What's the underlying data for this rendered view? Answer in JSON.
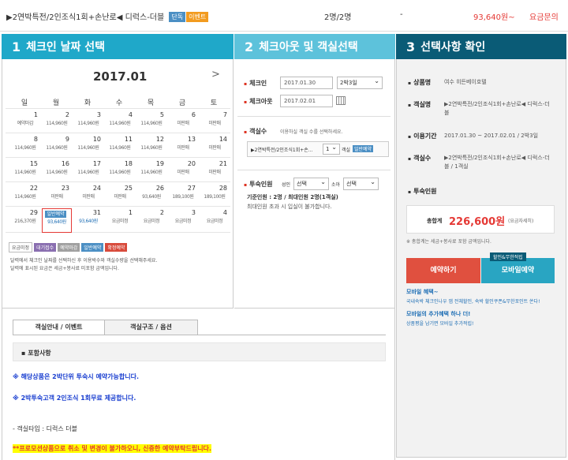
{
  "top": {
    "room_name": "▶2연박특전/2인조식1회+손난로◀ 디럭스-더블",
    "badge_single": "단독",
    "badge_event": "이벤트",
    "persons": "2명/2명",
    "dash": "-",
    "price": "93,640원~",
    "inquiry": "요금문의"
  },
  "steps": [
    {
      "num": "1",
      "label": "체크인 날짜 선택"
    },
    {
      "num": "2",
      "label": "체크아웃 및 객실선택"
    },
    {
      "num": "3",
      "label": "선택사항 확인"
    }
  ],
  "calendar": {
    "title": "2017.01",
    "next": ">",
    "weekdays": [
      "일",
      "월",
      "화",
      "수",
      "목",
      "금",
      "토"
    ],
    "weeks": [
      [
        {
          "d": "1",
          "v": "예약마감"
        },
        {
          "d": "2",
          "v": "114,960원"
        },
        {
          "d": "3",
          "v": "114,960원"
        },
        {
          "d": "4",
          "v": "114,960원"
        },
        {
          "d": "5",
          "v": "114,960원"
        },
        {
          "d": "6",
          "v": "미판매"
        },
        {
          "d": "7",
          "v": "미판매"
        }
      ],
      [
        {
          "d": "8",
          "v": "114,960원"
        },
        {
          "d": "9",
          "v": "114,960원"
        },
        {
          "d": "10",
          "v": "114,960원"
        },
        {
          "d": "11",
          "v": "114,960원"
        },
        {
          "d": "12",
          "v": "114,960원"
        },
        {
          "d": "13",
          "v": "미판매"
        },
        {
          "d": "14",
          "v": "미판매"
        }
      ],
      [
        {
          "d": "15",
          "v": "114,960원"
        },
        {
          "d": "16",
          "v": "114,960원"
        },
        {
          "d": "17",
          "v": "114,960원"
        },
        {
          "d": "18",
          "v": "114,960원"
        },
        {
          "d": "19",
          "v": "114,960원"
        },
        {
          "d": "20",
          "v": "미판매"
        },
        {
          "d": "21",
          "v": "미판매"
        }
      ],
      [
        {
          "d": "22",
          "v": "114,960원"
        },
        {
          "d": "23",
          "v": "미판매"
        },
        {
          "d": "24",
          "v": "미판매"
        },
        {
          "d": "25",
          "v": "미판매"
        },
        {
          "d": "26",
          "v": "93,640원"
        },
        {
          "d": "27",
          "v": "189,100원"
        },
        {
          "d": "28",
          "v": "189,100원"
        }
      ],
      [
        {
          "d": "29",
          "v": "216,370원"
        },
        {
          "d": "",
          "v": "93,640원",
          "tag": "일반예약",
          "sel": true
        },
        {
          "d": "31",
          "v": "93,640원",
          "blue": true
        },
        {
          "d": "1",
          "v": "요금미정"
        },
        {
          "d": "2",
          "v": "요금미정"
        },
        {
          "d": "3",
          "v": "요금미정"
        },
        {
          "d": "4",
          "v": "요금미정"
        }
      ]
    ],
    "legend": [
      {
        "label": "요금미정",
        "bg": "#ffffff",
        "fg": "#555"
      },
      {
        "label": "대기접수",
        "bg": "#8a6fb0",
        "fg": "#fff"
      },
      {
        "label": "예약마감",
        "bg": "#a0a0a0",
        "fg": "#fff"
      },
      {
        "label": "일반예약",
        "bg": "#4b8fc4",
        "fg": "#fff"
      },
      {
        "label": "확정예약",
        "bg": "#d84a3b",
        "fg": "#fff"
      }
    ],
    "note1": "달력에서 체크인 날짜를 선택하신 후 이용박수와 객실수량을 선택해주세요.",
    "note2": "달력에 표시된 요금은 세금+봉사료 미포함 금액입니다."
  },
  "checkout": {
    "checkin_label": "체크인",
    "checkin_value": "2017.01.30",
    "nights": "2박3일",
    "checkout_label": "체크아웃",
    "checkout_value": "2017.02.01",
    "rooms_label": "객실수",
    "rooms_hint": "이용하실 객실 수를 선택하세요.",
    "room_item": "▶2연박특전/2인조식1회+손...",
    "room_qty": "1",
    "room_unit": "객실",
    "room_tag": "일반예약",
    "guests_label": "투숙인원",
    "adult_label": "성인",
    "adult_select": "선택",
    "child_label": "소아",
    "child_select": "선택",
    "capacity": "기준인원 : 2명 / 최대인원 2명(1객실)",
    "capacity_note": "최대인원 초과 시 입실이 불가합니다."
  },
  "summary": {
    "product_label": "상품명",
    "product_value": "여수 히든베이호텔",
    "room_label": "객실명",
    "room_value": "▶2연박특전/2인조식1회+손난로◀ 디럭스-더블",
    "period_label": "이용기간",
    "period_value": "2017.01.30 ~ 2017.02.01 / 2박3일",
    "count_label": "객실수",
    "count_value": "▶2연박특전/2인조식1회+손난로◀ 디럭스-더블 / 1객실",
    "guests_label": "투숙인원",
    "total_label": "총합계",
    "total_value": "226,600원",
    "total_note": "(요금자세히)",
    "tax_note": "※ 총합계는 세금+봉사료 포함 금액입니다.",
    "reserve_button": "예약하기",
    "mobile_button": "모바일예약",
    "mobile_badge": "할인&무한적립",
    "benefit_title": "모바일 혜택~",
    "benefit_text": "국내숙박 체크인나우 앱 전체할인, 숙박 할인쿠폰&무한포인트 쏜다!",
    "fav_title": "모바일의 추가혜택 하나 더!",
    "fav_text": "상품평을 남기면 모바일 추가적립!"
  },
  "tabs": [
    "객실안내 / 이벤트",
    "객실구조 / 옵션"
  ],
  "info": {
    "included_title": "포함사항",
    "line1": "※ 해당상품은 2박단위 투숙시 예약가능합니다.",
    "line2": "※ 2박투숙고객 2인조식 1회무료 제공합니다.",
    "room_type": "- 객실타입 : 디럭스 더블",
    "warning": "**프로모션상품으로 취소 및 변경이 불가하오니, 신중한 예약부탁드립니다."
  },
  "colors": {
    "blue1": "#1fa8c9",
    "blue2": "#5dc2db",
    "blue3": "#0a5b76",
    "red": "#e53935",
    "reserve": "#e0503f",
    "mobile": "#29a5c2"
  }
}
